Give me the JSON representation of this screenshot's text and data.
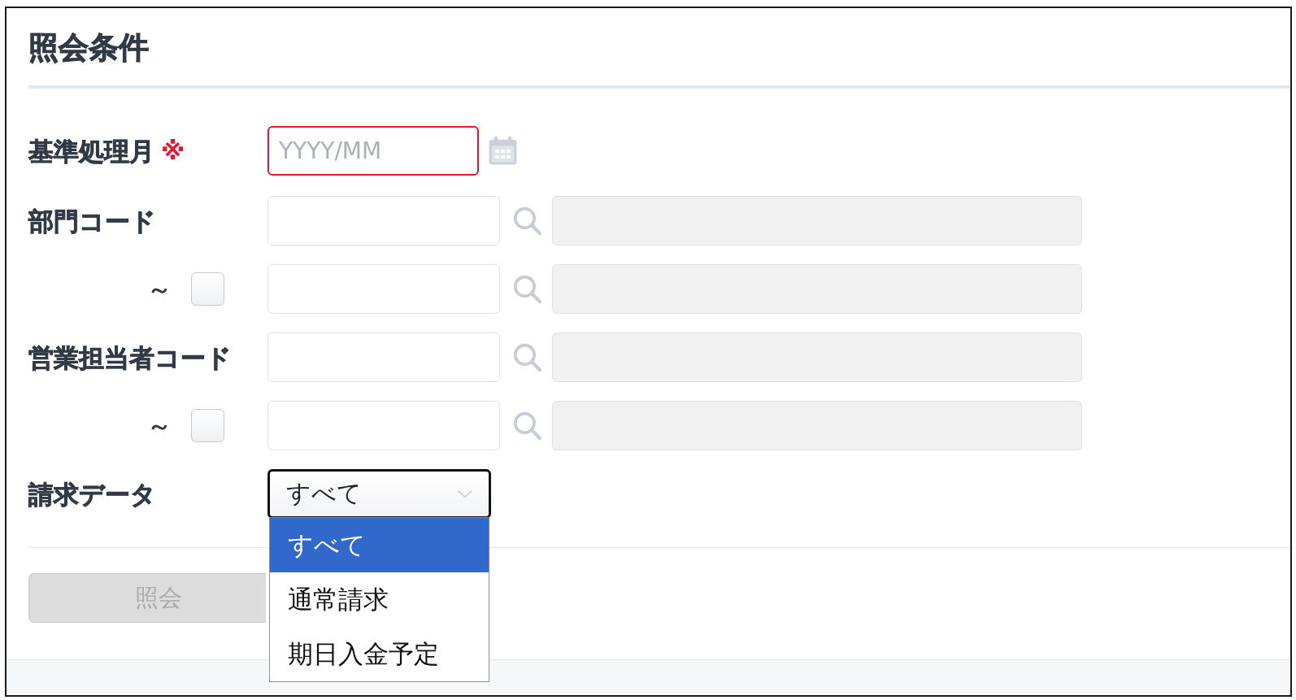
{
  "section": {
    "title": "照会条件"
  },
  "fields": [
    {
      "kind": "month",
      "label": "基準処理月",
      "required_mark": "※",
      "placeholder": "YYYY/MM",
      "invalid": true
    },
    {
      "kind": "code",
      "label": "部門コード"
    },
    {
      "kind": "range_end",
      "label": "～",
      "checked": false
    },
    {
      "kind": "code",
      "label": "営業担当者コード"
    },
    {
      "kind": "range_end",
      "label": "～",
      "checked": false
    },
    {
      "kind": "select",
      "label": "請求データ",
      "value": "すべて",
      "focused": true,
      "expanded": true,
      "options": [
        {
          "label": "すべて",
          "selected": true
        },
        {
          "label": "通常請求",
          "selected": false
        },
        {
          "label": "期日入金予定",
          "selected": false
        }
      ]
    }
  ],
  "buttons": [
    {
      "label": "照会",
      "disabled": true
    }
  ]
}
